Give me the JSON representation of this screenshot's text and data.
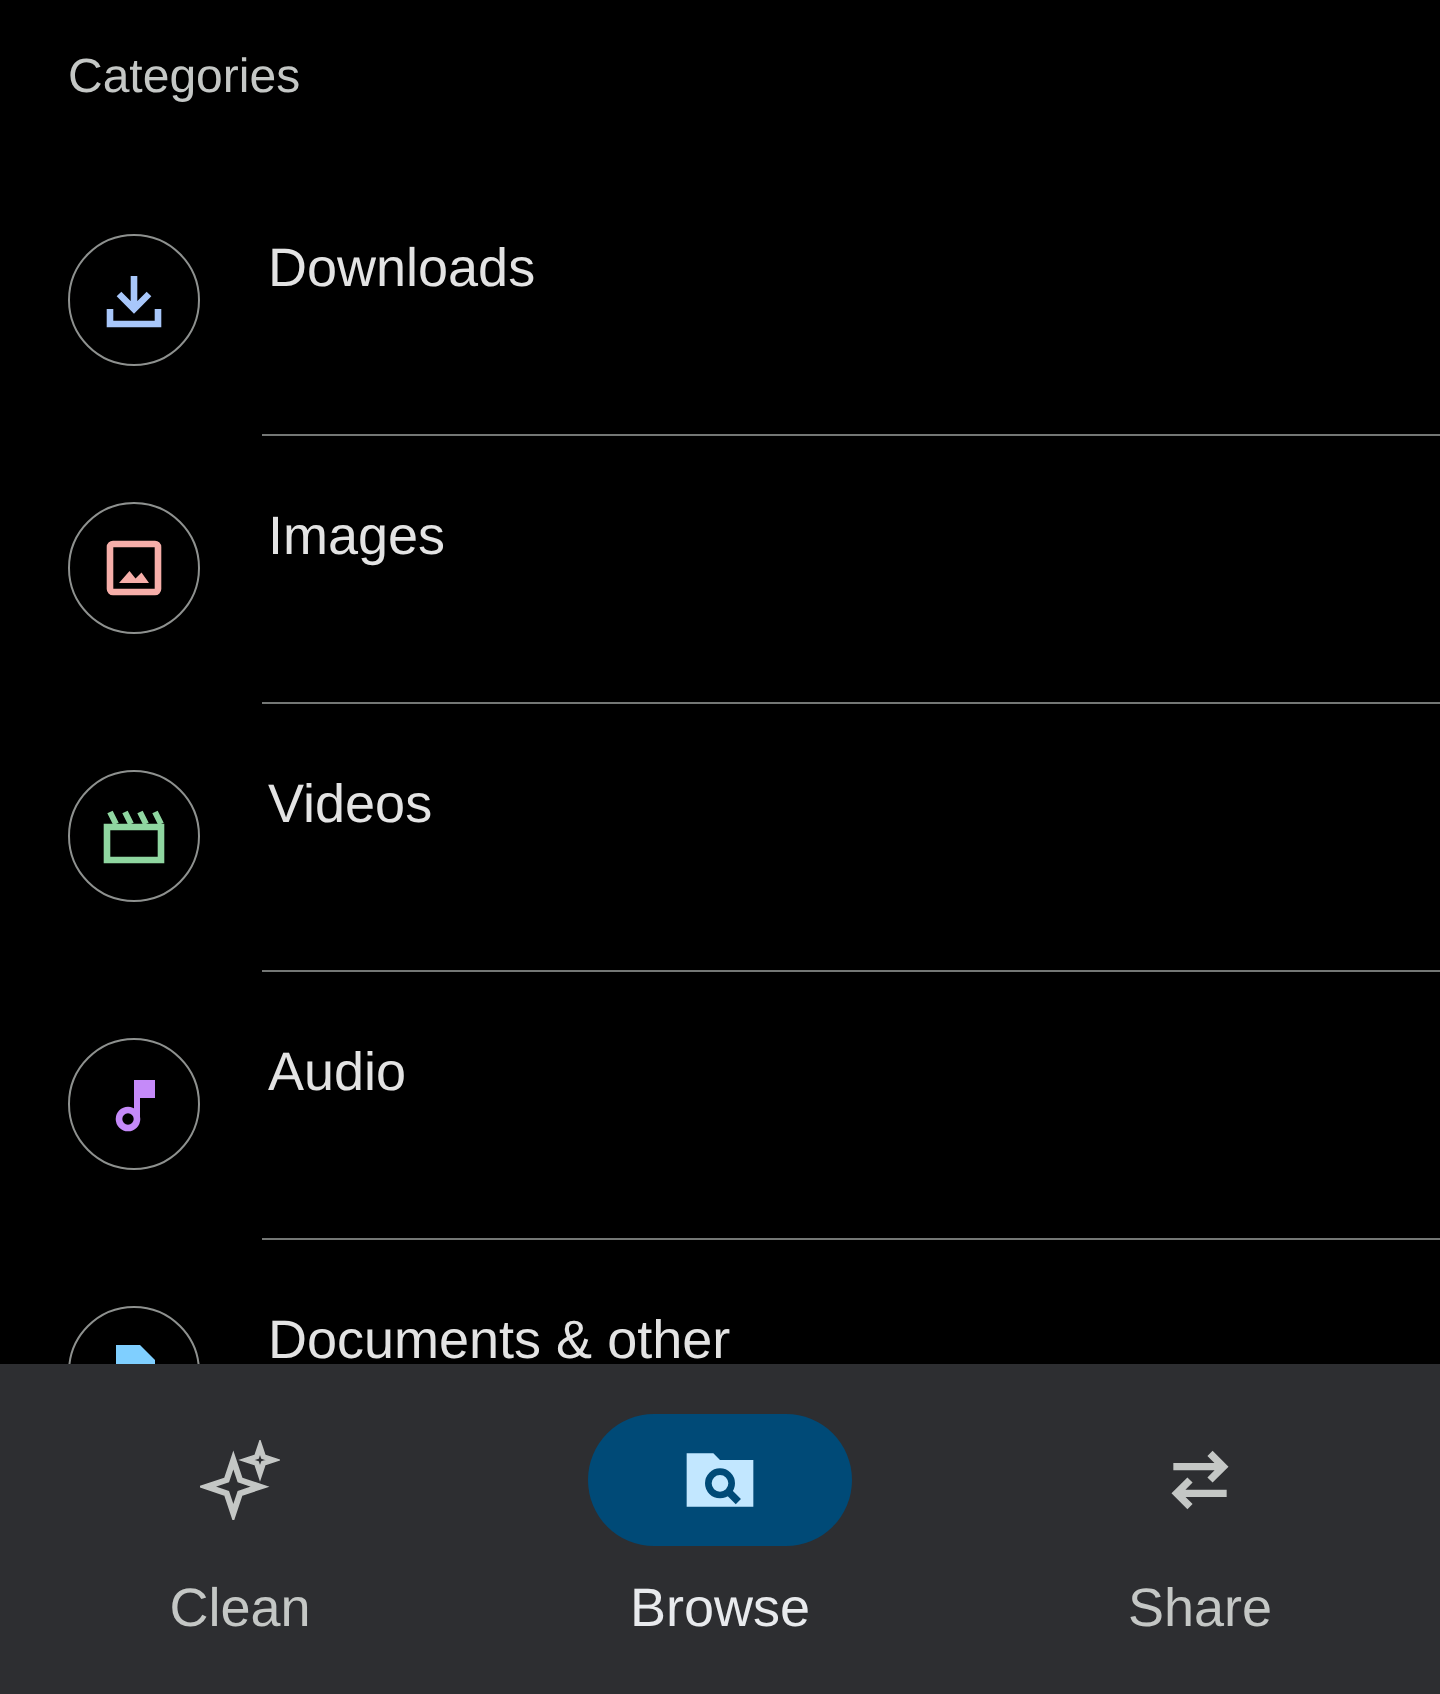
{
  "header": {
    "title": "Categories"
  },
  "categories": [
    {
      "label": "Downloads",
      "kind": "download",
      "color": "#a8c7fa"
    },
    {
      "label": "Images",
      "kind": "image",
      "color": "#f6aea9"
    },
    {
      "label": "Videos",
      "kind": "video",
      "color": "#8fd6a0"
    },
    {
      "label": "Audio",
      "kind": "audio",
      "color": "#c58af9"
    },
    {
      "label": "Documents & other",
      "kind": "document",
      "color": "#7fcfff"
    }
  ],
  "bottom_nav": [
    {
      "label": "Clean",
      "kind": "sparkle",
      "selected": false
    },
    {
      "label": "Browse",
      "kind": "browse",
      "selected": true
    },
    {
      "label": "Share",
      "kind": "swap",
      "selected": false
    }
  ]
}
